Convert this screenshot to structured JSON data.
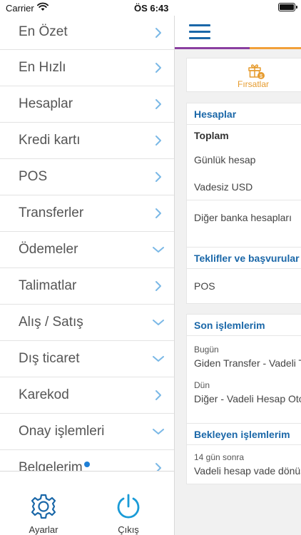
{
  "status_bar": {
    "carrier": "Carrier",
    "time": "ÖS 6:43",
    "icons": [
      "wifi-icon",
      "battery-icon"
    ]
  },
  "sidebar": {
    "items": [
      {
        "label": "En Özet",
        "chevron": "right"
      },
      {
        "label": "En Hızlı",
        "chevron": "right"
      },
      {
        "label": "Hesaplar",
        "chevron": "right"
      },
      {
        "label": "Kredi kartı",
        "chevron": "right"
      },
      {
        "label": "POS",
        "chevron": "right"
      },
      {
        "label": "Transferler",
        "chevron": "right"
      },
      {
        "label": "Ödemeler",
        "chevron": "down"
      },
      {
        "label": "Talimatlar",
        "chevron": "right"
      },
      {
        "label": "Alış / Satış",
        "chevron": "down"
      },
      {
        "label": "Dış ticaret",
        "chevron": "down"
      },
      {
        "label": "Karekod",
        "chevron": "right"
      },
      {
        "label": "Onay işlemleri",
        "chevron": "down"
      },
      {
        "label": "Belgelerim",
        "chevron": "right",
        "badge_dot": true
      }
    ],
    "footer": {
      "settings_label": "Ayarlar",
      "logout_label": "Çıkış",
      "settings_icon": "gear-icon",
      "logout_icon": "power-icon"
    }
  },
  "main": {
    "menu_icon": "hamburger-menu-icon",
    "opportunities": {
      "label": "Fırsatlar",
      "icon": "gift-icon"
    },
    "accounts": {
      "title": "Hesaplar",
      "total_label": "Toplam",
      "rows": [
        "Günlük hesap",
        "Vadesiz USD",
        "Diğer banka hesapları"
      ]
    },
    "offers": {
      "title": "Teklifler ve başvurular",
      "rows": [
        "POS"
      ]
    },
    "recent": {
      "title": "Son işlemlerim",
      "groups": [
        {
          "date": "Bugün",
          "text": "Giden Transfer - Vadeli TL"
        },
        {
          "date": "Dün",
          "text": "Diğer - Vadeli Hesap Otom"
        }
      ]
    },
    "pending": {
      "title": "Bekleyen işlemlerim",
      "groups": [
        {
          "date": "14 gün sonra",
          "text": "Vadeli hesap vade dönüşü"
        }
      ]
    }
  },
  "colors": {
    "primary_blue": "#1a67a8",
    "accent_purple": "#8a3fa0",
    "accent_orange": "#f2a03a",
    "chevron_blue": "#7ab8e6",
    "badge_blue": "#1f7fd6"
  }
}
